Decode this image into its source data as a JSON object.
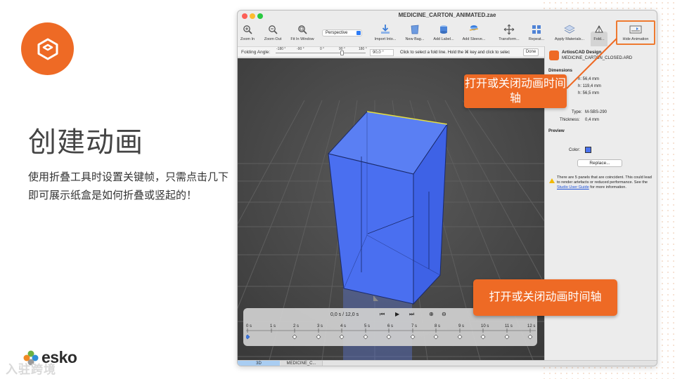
{
  "slide": {
    "title": "创建动画",
    "body": "使用折叠工具时设置关键帧，只需点击几下即可展示纸盒是如何折叠或竖起的！",
    "brand": "esko",
    "watermark": "入驻跨境"
  },
  "window": {
    "title": "MEDICINE_CARTON_ANIMATED.zae"
  },
  "toolbar": {
    "zoom_in": "Zoom In",
    "zoom_out": "Zoom Out",
    "fit_window": "Fit In Window",
    "view_mode": "Perspective",
    "import": "Import Into...",
    "new_bag": "New Bag...",
    "add_label": "Add Label...",
    "add_sleeve": "Add Sleeve...",
    "transform": "Transform...",
    "repeat": "Repeat...",
    "apply_materials": "Apply Materials...",
    "fold": "Fold...",
    "hide_animation": "Hide Animation"
  },
  "foldbar": {
    "label": "Folding Angle:",
    "ticks": [
      "-180 °",
      "-90 °",
      "0 °",
      "90 °",
      "180 °"
    ],
    "value": "90,0 °",
    "hint": "Click to select a fold line. Hold the ⌘ key and click to selec",
    "done": "Done"
  },
  "timeline": {
    "current": "0,0 s",
    "total": "12,0 s",
    "scale": [
      "0 s",
      "1 s",
      "2 s",
      "3 s",
      "4 s",
      "5 s",
      "6 s",
      "7 s",
      "8 s",
      "9 s",
      "10 s",
      "11 s",
      "12 s"
    ]
  },
  "panel": {
    "app_name": "ArtiosCAD Design",
    "file": "MEDICINE_CARTON_CLOSED.ARD",
    "dimensions_heading": "Dimensions",
    "dim1": "h: 56,4 mm",
    "dim2": "h: 119,4 mm",
    "dim3": "h: 56,5 mm",
    "type_label": "Type:",
    "type_value": "M-SBS-290",
    "thickness_label": "Thickness:",
    "thickness_value": "0,4 mm",
    "preview_heading": "Preview",
    "color_label": "Color:",
    "replace": "Replace...",
    "warning_text": "There are 5 panels that are coincident. This could lead to render artefacts or reduced performance. See the",
    "warning_link": "Studio User Guide",
    "warning_tail": "for more information."
  },
  "statusbar": {
    "tab1": "3D",
    "tab2": "MEDICINE_C..."
  },
  "callouts": {
    "top": "打开或关闭动画时间轴",
    "bottom": "打开或关闭动画时间轴"
  },
  "colors": {
    "accent": "#ee6a25",
    "carton": "#4a72ef",
    "viewport": "#4a4a4a"
  }
}
